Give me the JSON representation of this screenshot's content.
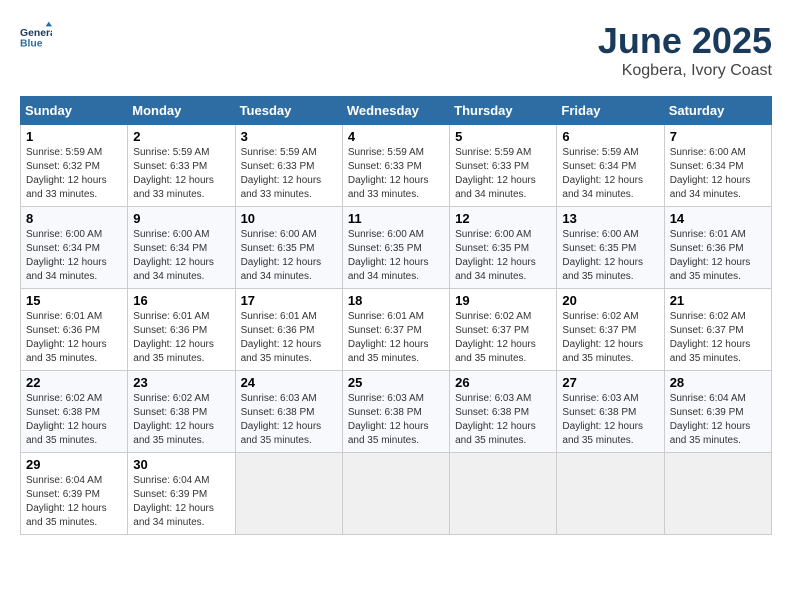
{
  "header": {
    "logo_line1": "General",
    "logo_line2": "Blue",
    "title": "June 2025",
    "subtitle": "Kogbera, Ivory Coast"
  },
  "days_of_week": [
    "Sunday",
    "Monday",
    "Tuesday",
    "Wednesday",
    "Thursday",
    "Friday",
    "Saturday"
  ],
  "weeks": [
    [
      {
        "day": 1,
        "sunrise": "5:59 AM",
        "sunset": "6:32 PM",
        "daylight": "12 hours and 33 minutes."
      },
      {
        "day": 2,
        "sunrise": "5:59 AM",
        "sunset": "6:33 PM",
        "daylight": "12 hours and 33 minutes."
      },
      {
        "day": 3,
        "sunrise": "5:59 AM",
        "sunset": "6:33 PM",
        "daylight": "12 hours and 33 minutes."
      },
      {
        "day": 4,
        "sunrise": "5:59 AM",
        "sunset": "6:33 PM",
        "daylight": "12 hours and 33 minutes."
      },
      {
        "day": 5,
        "sunrise": "5:59 AM",
        "sunset": "6:33 PM",
        "daylight": "12 hours and 34 minutes."
      },
      {
        "day": 6,
        "sunrise": "5:59 AM",
        "sunset": "6:34 PM",
        "daylight": "12 hours and 34 minutes."
      },
      {
        "day": 7,
        "sunrise": "6:00 AM",
        "sunset": "6:34 PM",
        "daylight": "12 hours and 34 minutes."
      }
    ],
    [
      {
        "day": 8,
        "sunrise": "6:00 AM",
        "sunset": "6:34 PM",
        "daylight": "12 hours and 34 minutes."
      },
      {
        "day": 9,
        "sunrise": "6:00 AM",
        "sunset": "6:34 PM",
        "daylight": "12 hours and 34 minutes."
      },
      {
        "day": 10,
        "sunrise": "6:00 AM",
        "sunset": "6:35 PM",
        "daylight": "12 hours and 34 minutes."
      },
      {
        "day": 11,
        "sunrise": "6:00 AM",
        "sunset": "6:35 PM",
        "daylight": "12 hours and 34 minutes."
      },
      {
        "day": 12,
        "sunrise": "6:00 AM",
        "sunset": "6:35 PM",
        "daylight": "12 hours and 34 minutes."
      },
      {
        "day": 13,
        "sunrise": "6:00 AM",
        "sunset": "6:35 PM",
        "daylight": "12 hours and 35 minutes."
      },
      {
        "day": 14,
        "sunrise": "6:01 AM",
        "sunset": "6:36 PM",
        "daylight": "12 hours and 35 minutes."
      }
    ],
    [
      {
        "day": 15,
        "sunrise": "6:01 AM",
        "sunset": "6:36 PM",
        "daylight": "12 hours and 35 minutes."
      },
      {
        "day": 16,
        "sunrise": "6:01 AM",
        "sunset": "6:36 PM",
        "daylight": "12 hours and 35 minutes."
      },
      {
        "day": 17,
        "sunrise": "6:01 AM",
        "sunset": "6:36 PM",
        "daylight": "12 hours and 35 minutes."
      },
      {
        "day": 18,
        "sunrise": "6:01 AM",
        "sunset": "6:37 PM",
        "daylight": "12 hours and 35 minutes."
      },
      {
        "day": 19,
        "sunrise": "6:02 AM",
        "sunset": "6:37 PM",
        "daylight": "12 hours and 35 minutes."
      },
      {
        "day": 20,
        "sunrise": "6:02 AM",
        "sunset": "6:37 PM",
        "daylight": "12 hours and 35 minutes."
      },
      {
        "day": 21,
        "sunrise": "6:02 AM",
        "sunset": "6:37 PM",
        "daylight": "12 hours and 35 minutes."
      }
    ],
    [
      {
        "day": 22,
        "sunrise": "6:02 AM",
        "sunset": "6:38 PM",
        "daylight": "12 hours and 35 minutes."
      },
      {
        "day": 23,
        "sunrise": "6:02 AM",
        "sunset": "6:38 PM",
        "daylight": "12 hours and 35 minutes."
      },
      {
        "day": 24,
        "sunrise": "6:03 AM",
        "sunset": "6:38 PM",
        "daylight": "12 hours and 35 minutes."
      },
      {
        "day": 25,
        "sunrise": "6:03 AM",
        "sunset": "6:38 PM",
        "daylight": "12 hours and 35 minutes."
      },
      {
        "day": 26,
        "sunrise": "6:03 AM",
        "sunset": "6:38 PM",
        "daylight": "12 hours and 35 minutes."
      },
      {
        "day": 27,
        "sunrise": "6:03 AM",
        "sunset": "6:38 PM",
        "daylight": "12 hours and 35 minutes."
      },
      {
        "day": 28,
        "sunrise": "6:04 AM",
        "sunset": "6:39 PM",
        "daylight": "12 hours and 35 minutes."
      }
    ],
    [
      {
        "day": 29,
        "sunrise": "6:04 AM",
        "sunset": "6:39 PM",
        "daylight": "12 hours and 35 minutes."
      },
      {
        "day": 30,
        "sunrise": "6:04 AM",
        "sunset": "6:39 PM",
        "daylight": "12 hours and 34 minutes."
      },
      null,
      null,
      null,
      null,
      null
    ]
  ]
}
